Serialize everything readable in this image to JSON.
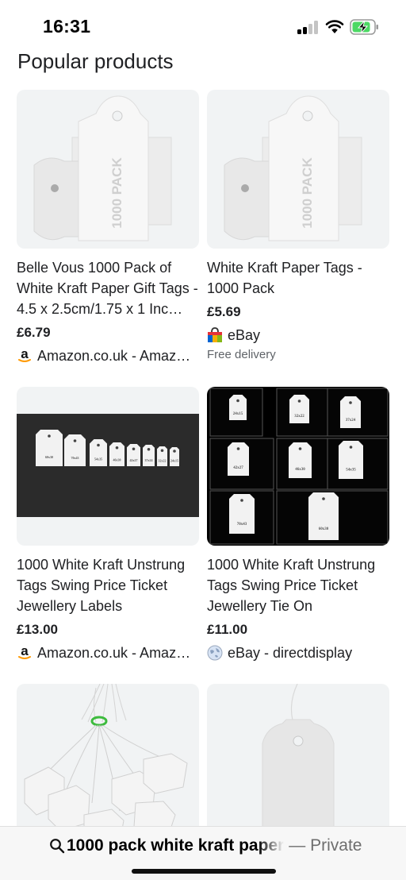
{
  "status_bar": {
    "time": "16:31",
    "signal_icon": "cellular-signal-icon",
    "wifi_icon": "wifi-icon",
    "battery_icon": "battery-charging-icon"
  },
  "page": {
    "title": "Popular products"
  },
  "products": [
    {
      "image_text": "1000 PACK",
      "title": "Belle Vous 1000 Pack of White Kraft Paper Gift Tags - 4.5 x 2.5cm/1.75 x 1 Inc…",
      "price": "£6.79",
      "seller": "Amazon.co.uk - Amaz…",
      "seller_icon": "amazon-icon"
    },
    {
      "image_text": "1000 PACK",
      "title": "White Kraft Paper Tags - 1000 Pack",
      "price": "£5.69",
      "seller": "eBay",
      "seller_icon": "ebay-bag-icon",
      "delivery": "Free delivery"
    },
    {
      "image_labels": [
        "60x30",
        "70x43",
        "54x35",
        "46x30",
        "42x27",
        "37x24",
        "32x22",
        "24x15"
      ],
      "title": "1000 White Kraft Unstrung Tags Swing Price Ticket Jewellery Labels",
      "price": "£13.00",
      "seller": "Amazon.co.uk - Amaz…",
      "seller_icon": "amazon-icon"
    },
    {
      "image_labels": [
        "24x15",
        "32x22",
        "37x24",
        "42x27",
        "46x30",
        "54x35",
        "70x43",
        "60x30"
      ],
      "title": "1000 White Kraft Unstrung Tags Swing Price Ticket Jewellery Tie On",
      "price": "£11.00",
      "seller": "eBay - directdisplay",
      "seller_icon": "globe-icon"
    },
    {
      "title": "",
      "image_icon": "strung-tags-bundle-image"
    },
    {
      "title": "",
      "image_icon": "single-tag-image"
    }
  ],
  "address_bar": {
    "search_icon": "search-icon",
    "query": "1000 pack white kraft paper",
    "mode": "— Private"
  },
  "colors": {
    "card_bg": "#f1f3f4",
    "text": "#202124",
    "muted": "#5f6368",
    "battery_green": "#4cd964",
    "bundle_ring": "#3dbb3d"
  }
}
